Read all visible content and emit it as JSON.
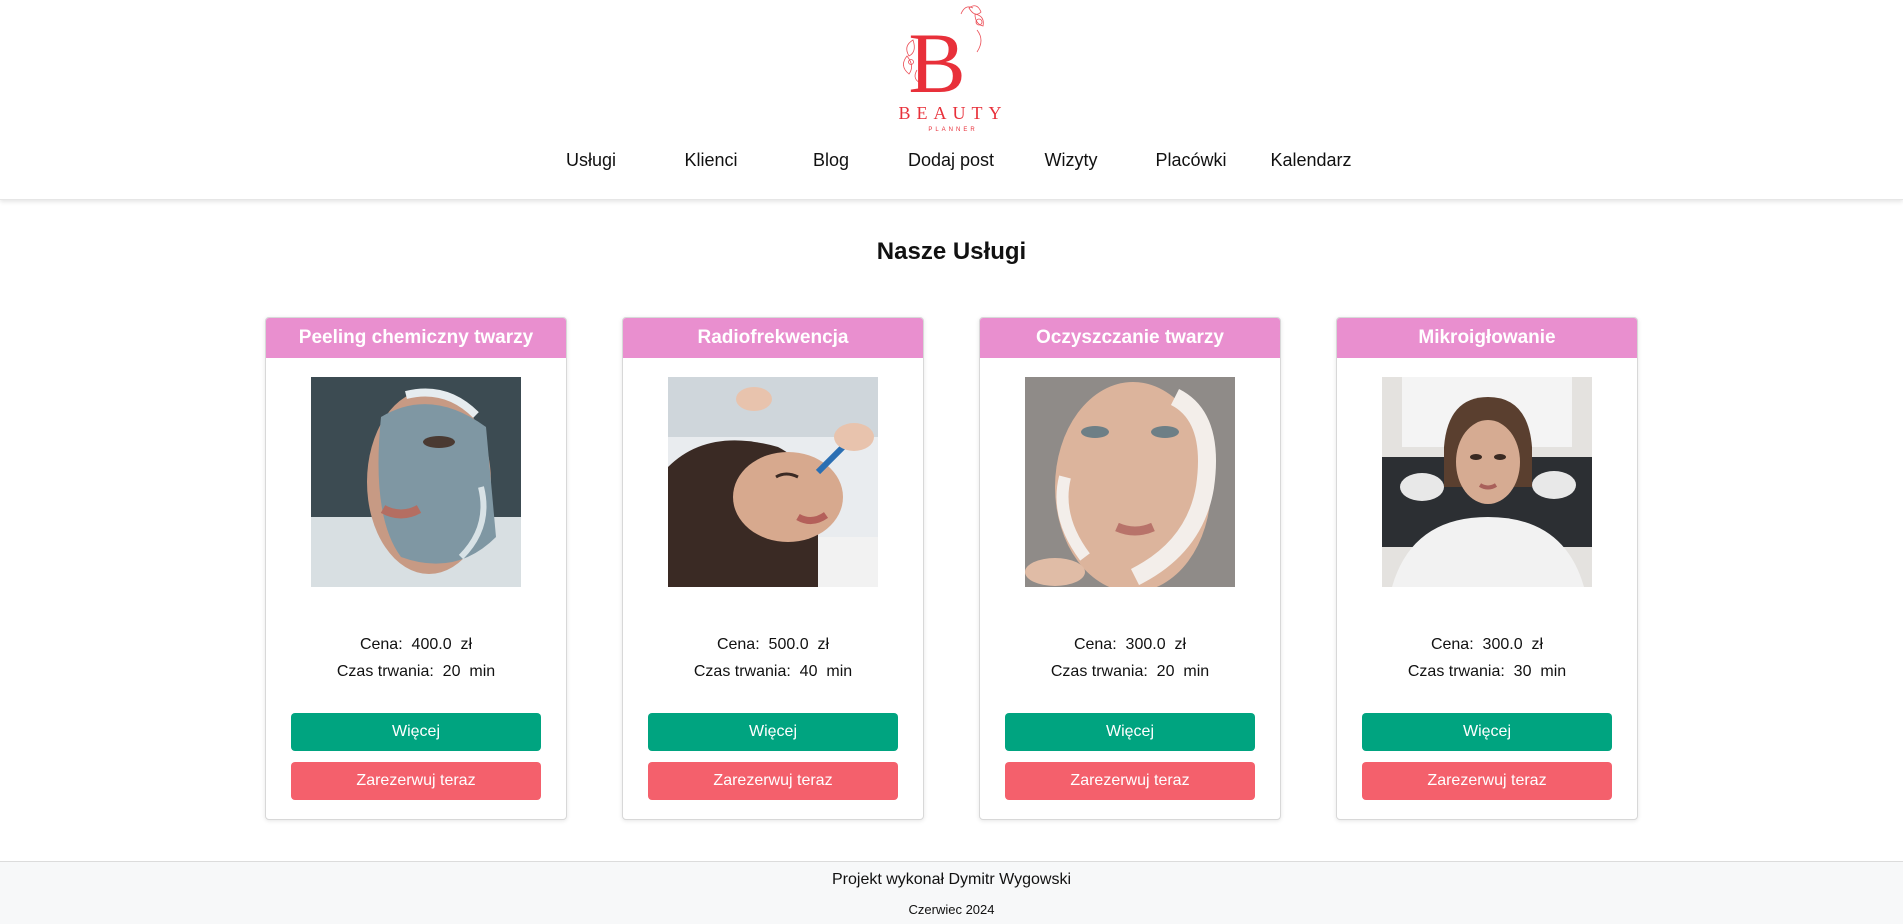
{
  "brand": {
    "logo_letter": "B",
    "logo_name": "BEAUTY",
    "logo_tagline": "PLANNER",
    "color": "#e8303a"
  },
  "nav": {
    "items": [
      {
        "label": "Usługi"
      },
      {
        "label": "Klienci"
      },
      {
        "label": "Blog"
      },
      {
        "label": "Dodaj post"
      },
      {
        "label": "Wizyty"
      },
      {
        "label": "Placówki"
      },
      {
        "label": "Kalendarz"
      }
    ]
  },
  "main": {
    "title": "Nasze Usługi"
  },
  "services": [
    {
      "name": "Peeling chemiczny twarzy",
      "price_label": "Cena:",
      "price": "400.0",
      "currency": "zł",
      "duration_label": "Czas trwania:",
      "duration": "20",
      "unit": "min",
      "more_label": "Więcej",
      "book_label": "Zarezerwuj teraz",
      "image_icon": "face-mask-photo"
    },
    {
      "name": "Radiofrekwencja",
      "price_label": "Cena:",
      "price": "500.0",
      "currency": "zł",
      "duration_label": "Czas trwania:",
      "duration": "40",
      "unit": "min",
      "more_label": "Więcej",
      "book_label": "Zarezerwuj teraz",
      "image_icon": "lip-treatment-photo"
    },
    {
      "name": "Oczyszczanie twarzy",
      "price_label": "Cena:",
      "price": "300.0",
      "currency": "zł",
      "duration_label": "Czas trwania:",
      "duration": "20",
      "unit": "min",
      "more_label": "Więcej",
      "book_label": "Zarezerwuj teraz",
      "image_icon": "face-cream-photo"
    },
    {
      "name": "Mikroigłowanie",
      "price_label": "Cena:",
      "price": "300.0",
      "currency": "zł",
      "duration_label": "Czas trwania:",
      "duration": "30",
      "unit": "min",
      "more_label": "Więcej",
      "book_label": "Zarezerwuj teraz",
      "image_icon": "microneedling-photo"
    }
  ],
  "footer": {
    "author": "Projekt wykonał Dymitr Wygowski",
    "date": "Czerwiec 2024"
  },
  "colors": {
    "card_header": "#e98fcf",
    "more_button": "#00a480",
    "book_button": "#f4606c"
  }
}
